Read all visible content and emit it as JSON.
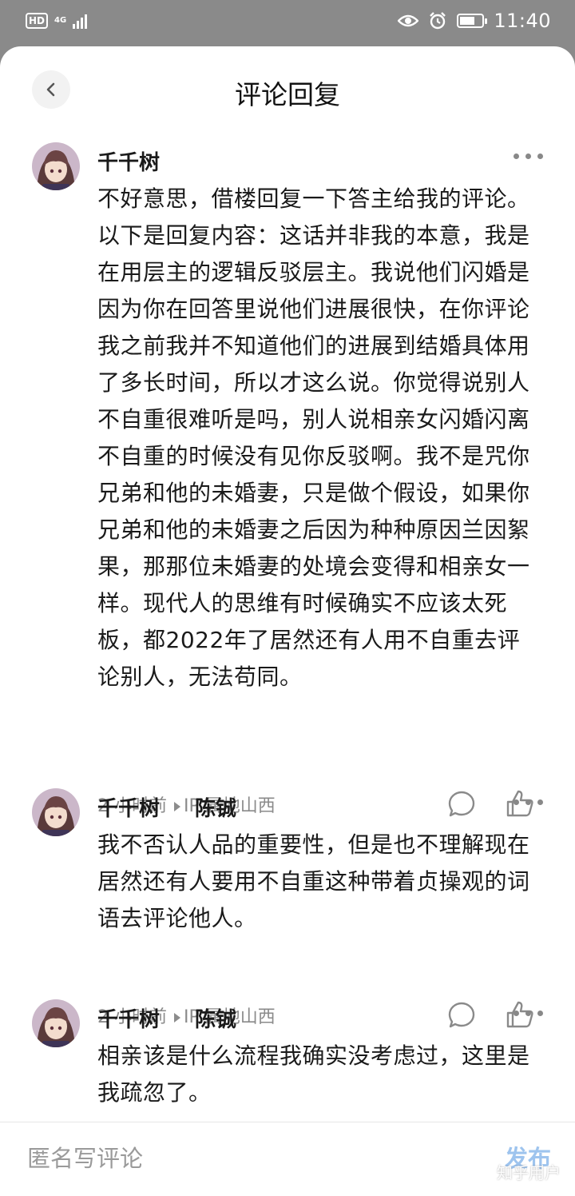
{
  "status_bar": {
    "hd": "HD",
    "network": "4G",
    "time": "11:40",
    "battery_level": 0.7
  },
  "header": {
    "title": "评论回复"
  },
  "comments": [
    {
      "author": "千千树",
      "reply_to": "",
      "content": "不好意思，借楼回复一下答主给我的评论。以下是回复内容：这话并非我的本意，我是在用层主的逻辑反驳层主。我说他们闪婚是因为你在回答里说他们进展很快，在你评论我之前我并不知道他们的进展到结婚具体用了多长时间，所以才这么说。你觉得说别人不自重很难听是吗，别人说相亲女闪婚闪离不自重的时候没有见你反驳啊。我不是咒你兄弟和他的未婚妻，只是做个假设，如果你兄弟和他的未婚妻之后因为种种原因兰因絮果，那那位未婚妻的处境会变得和相亲女一样。现代人的思维有时候确实不应该太死板，都2022年了居然还有人用不自重去评论别人，无法苟同。",
      "time": "2 小时前",
      "ip": "IP 属地山西"
    },
    {
      "author": "千千树",
      "reply_to": "陈铖",
      "content": "我不否认人品的重要性，但是也不理解现在居然还有人要用不自重这种带着贞操观的词语去评论他人。",
      "time": "2 小时前",
      "ip": "IP 属地山西"
    },
    {
      "author": "千千树",
      "reply_to": "陈铖",
      "content": "相亲该是什么流程我确实没考虑过，这里是我疏忽了。",
      "time": "",
      "ip": ""
    }
  ],
  "meta_separator": "·",
  "compose": {
    "placeholder": "匿名写评论",
    "publish_label": "发布"
  },
  "watermark": "知乎用户",
  "colors": {
    "status_bar_bg": "#8a8a8a",
    "text_primary": "#1a1a1a",
    "text_secondary": "#8a8a8a",
    "publish_disabled": "#9ec4ee"
  }
}
